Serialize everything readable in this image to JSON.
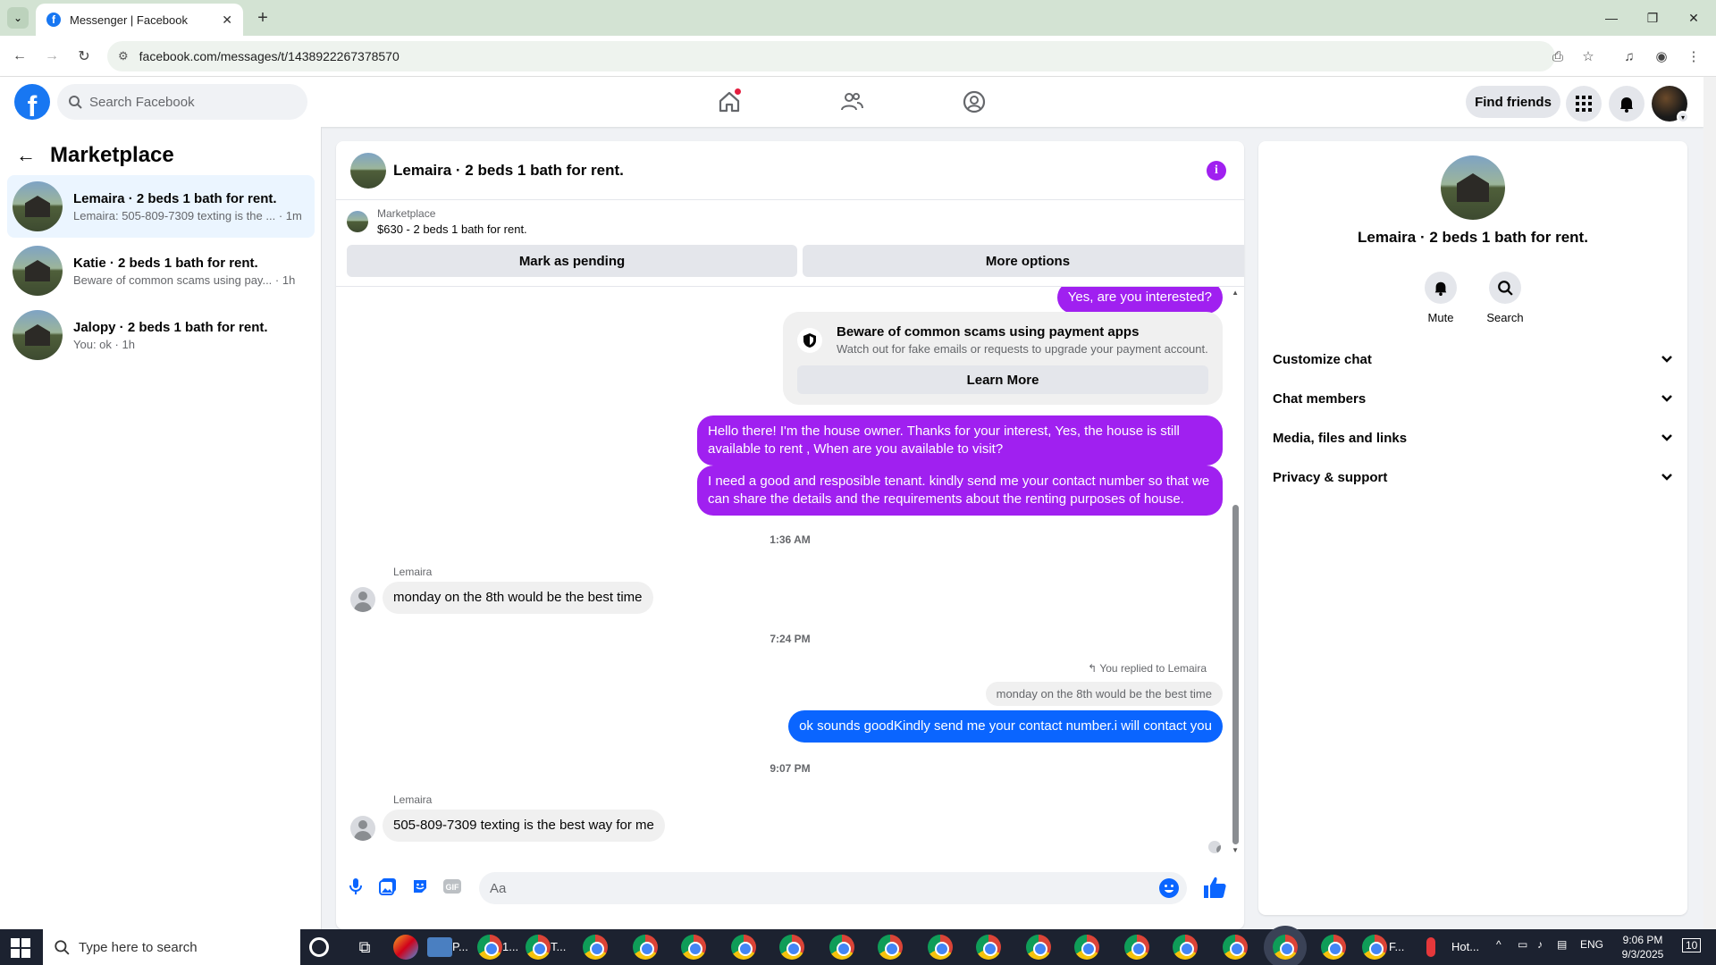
{
  "browser": {
    "tab_title": "Messenger | Facebook",
    "url": "facebook.com/messages/t/1438922267378570"
  },
  "fb": {
    "logo": "f",
    "search_placeholder": "Search Facebook",
    "find_friends": "Find friends"
  },
  "left": {
    "title": "Marketplace",
    "conversations": [
      {
        "name": "Lemaira · 2 beds 1 bath for rent.",
        "preview": "Lemaira: 505-809-7309 texting is the ...",
        "time": "· 1m"
      },
      {
        "name": "Katie · 2 beds 1 bath for rent.",
        "preview": "Beware of common scams using pay...",
        "time": "· 1h"
      },
      {
        "name": "Jalopy · 2 beds 1 bath for rent.",
        "preview": "You: ok",
        "time": "· 1h"
      }
    ]
  },
  "chat": {
    "title": "Lemaira · 2 beds 1 bath for rent.",
    "listing_label": "Marketplace",
    "listing_detail": "$630 - 2 beds 1 bath for rent.",
    "mark_pending": "Mark as pending",
    "more_options": "More options",
    "msg_yes": "Yes, are you interested?",
    "warn_title": "Beware of common scams using payment apps",
    "warn_sub": "Watch out for fake emails or requests to upgrade your payment account.",
    "learn_more": "Learn More",
    "msg_owner_1": "Hello there! I'm the house owner. Thanks for your interest, Yes, the house is still available to rent , When are you available to visit?",
    "msg_owner_2": "I need a good and resposible tenant.  kindly send me your contact number so that we can share the details and the requirements about the renting purposes of house.",
    "ts1": "1:36 AM",
    "sender1": "Lemaira",
    "msg_in_1": "monday on the 8th would be the best time",
    "ts2": "7:24 PM",
    "replied_label": "You replied to Lemaira",
    "quoted": "monday on the 8th would be the best time",
    "msg_out_blue": "ok sounds goodKindly send me your contact number.i will contact you",
    "ts3": "9:07 PM",
    "sender2": "Lemaira",
    "msg_in_2": "505-809-7309 texting is the best way for me",
    "input_placeholder": "Aa"
  },
  "right": {
    "name": "Lemaira · 2 beds 1 bath for rent.",
    "mute": "Mute",
    "search": "Search",
    "rows": [
      "Customize chat",
      "Chat members",
      "Media, files and links",
      "Privacy & support"
    ]
  },
  "taskbar": {
    "search_placeholder": "Type here to search",
    "app_labels": [
      "P...",
      "1...",
      "T...",
      "F...",
      "Hot..."
    ],
    "lang": "ENG",
    "time": "9:06 PM",
    "date": "9/3/2025",
    "notif_count": "10"
  },
  "colors": {
    "fb_blue": "#1877f2",
    "purple_bubble": "#a020f0",
    "blue_bubble": "#0a65ff"
  }
}
